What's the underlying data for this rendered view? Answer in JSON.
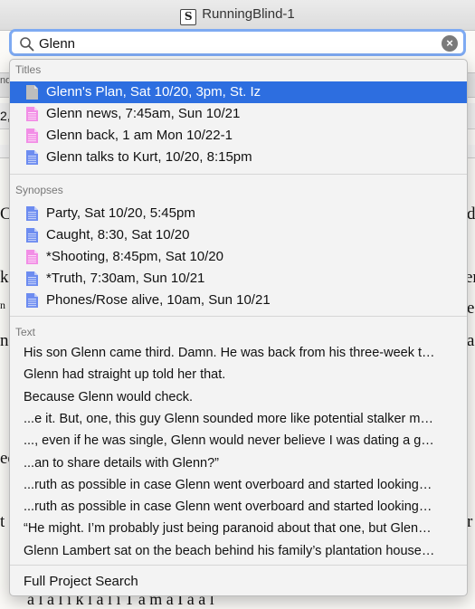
{
  "window": {
    "title": "RunningBlind-1"
  },
  "search": {
    "value": "Glenn"
  },
  "sections": {
    "titles": {
      "label": "Titles",
      "items": [
        {
          "label": "Glenn's Plan, Sat 10/20, 3pm, St. Iz",
          "icon": "page-icon",
          "color": "#bdbdbd"
        },
        {
          "label": "Glenn news, 7:45am, Sun 10/21",
          "icon": "text-document-icon",
          "color": "#f28ee6"
        },
        {
          "label": "Glenn back, 1 am Mon 10/22-1",
          "icon": "text-document-icon",
          "color": "#f28ee6"
        },
        {
          "label": "Glenn talks to Kurt, 10/20, 8:15pm",
          "icon": "text-document-icon",
          "color": "#6d8cf0"
        }
      ]
    },
    "synopses": {
      "label": "Synopses",
      "items": [
        {
          "label": "Party, Sat 10/20, 5:45pm",
          "icon": "text-document-icon",
          "color": "#6d8cf0"
        },
        {
          "label": "Caught, 8:30, Sat 10/20",
          "icon": "text-document-icon",
          "color": "#6d8cf0"
        },
        {
          "label": "*Shooting, 8:45pm, Sat 10/20",
          "icon": "text-document-icon",
          "color": "#f28ee6"
        },
        {
          "label": "*Truth, 7:30am, Sun 10/21",
          "icon": "text-document-icon",
          "color": "#6d8cf0"
        },
        {
          "label": "Phones/Rose alive, 10am, Sun 10/21",
          "icon": "text-document-icon",
          "color": "#6d8cf0"
        }
      ]
    },
    "text": {
      "label": "Text",
      "items": [
        "His son Glenn came third. Damn. He was back from his three-week t…",
        "Glenn had straight up told her that.",
        "Because Glenn would check.",
        "...e it. But, one, this guy Glenn sounded more like potential stalker m…",
        "..., even if he was single, Glenn would never believe I was dating a g…",
        "...an to share details with Glenn?”",
        "...ruth as possible in case Glenn went overboard and started looking…",
        "...ruth as possible in case Glenn went overboard and started looking…",
        "“He might. I’m probably just being paranoid about that one, but Glen…",
        "Glenn Lambert sat on the beach behind his family’s plantation house…"
      ]
    }
  },
  "footer": {
    "label": "Full Project Search"
  },
  "background": {
    "fragments": [
      "nd",
      "2,",
      "Ca",
      "k",
      "n",
      "no",
      "ec",
      "t",
      "d",
      "er",
      "e",
      "a",
      "r"
    ],
    "bottom_line": "a l a l i k l a l i      T a m a    I a a l"
  },
  "colors": {
    "selection": "#2d6ee0",
    "focus_ring": "#7eaaf2"
  }
}
